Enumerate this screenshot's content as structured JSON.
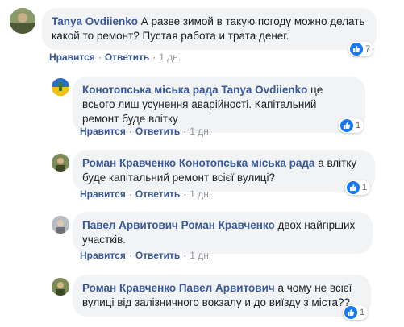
{
  "comments": [
    {
      "author": "Tanya Ovdiienko",
      "mention": "",
      "text": " А разве зимой в такую погоду можно делать какой то ремонт? Пустая работа и трата денег.",
      "like_label": "Нравится",
      "reply_label": "Ответить",
      "time": "1 дн.",
      "reactions_count": "7",
      "avatar_color": "#6b7a4f"
    },
    {
      "author": "Конотопська міська рада",
      "mention": "Tanya Ovdiienko",
      "text": " це всього лиш усунення аварійності. Капітальний ремонт буде влітку",
      "like_label": "Нравится",
      "reply_label": "Ответить",
      "time": "1 дн.",
      "reactions_count": "1",
      "avatar_color": "#2a6fc9"
    },
    {
      "author": "Роман Кравченко",
      "mention": "Конотопська міська рада",
      "text": " а влітку буде капітальний ремонт всієї вулиці?",
      "like_label": "Нравится",
      "reply_label": "Ответить",
      "time": "1 дн.",
      "reactions_count": "1",
      "avatar_color": "#5b6b3b"
    },
    {
      "author": "Павел Арвитович",
      "mention": "Роман Кравченко",
      "text": " двох найгірших участків.",
      "like_label": "Нравится",
      "reply_label": "Ответить",
      "time": "1 дн.",
      "reactions_count": "",
      "avatar_color": "#9aa0a6"
    },
    {
      "author": "Роман Кравченко",
      "mention": "Павел Арвитович",
      "text": " а чому не всієї вулиці від залізничного вокзалу и до виїзду з міста??",
      "like_label": "Нравится",
      "reply_label": "Ответить",
      "time": "1 дн.",
      "reactions_count": "1",
      "avatar_color": "#5b6b3b"
    }
  ],
  "separator": "·",
  "colors": {
    "link": "#385898",
    "bubble": "#f2f3f5",
    "like_blue": "#1877f2"
  }
}
